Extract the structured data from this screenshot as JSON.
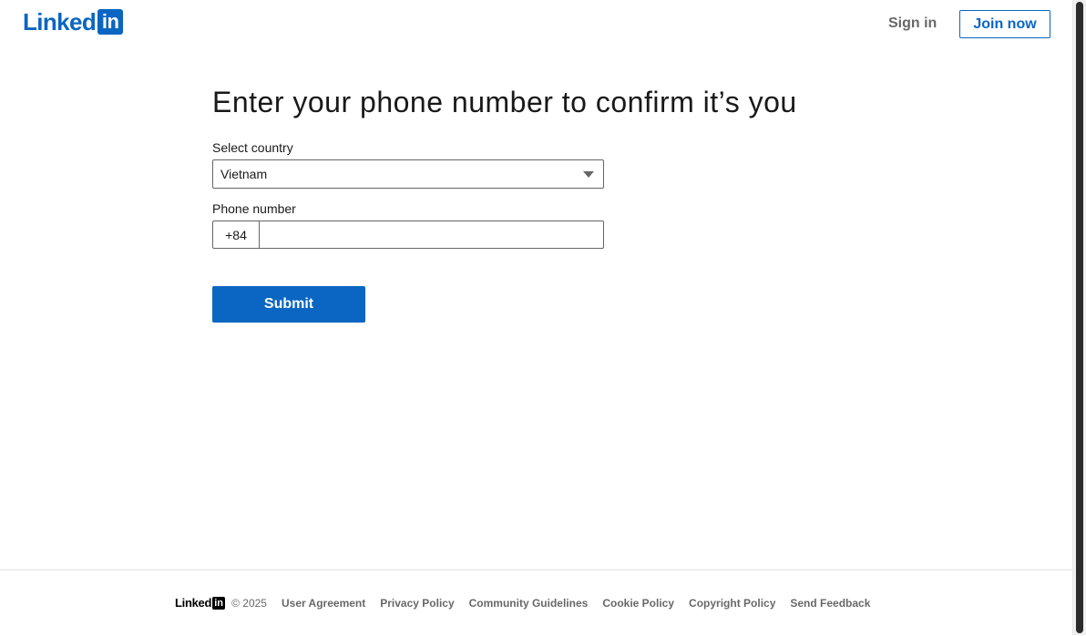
{
  "header": {
    "logo_word": "Linked",
    "logo_box": "in",
    "sign_in": "Sign in",
    "join_now": "Join now"
  },
  "main": {
    "title": "Enter your phone number to confirm it’s you",
    "country_label": "Select country",
    "country_value": "Vietnam",
    "phone_label": "Phone number",
    "phone_prefix": "+84",
    "phone_value": "",
    "submit_label": "Submit"
  },
  "footer": {
    "logo_word": "Linked",
    "logo_box": "in",
    "copyright": "© 2025",
    "links": [
      "User Agreement",
      "Privacy Policy",
      "Community Guidelines",
      "Cookie Policy",
      "Copyright Policy",
      "Send Feedback"
    ]
  },
  "colors": {
    "brand": "#0a66c2",
    "text_secondary": "rgba(0,0,0,0.6)"
  },
  "icons": {
    "caret": "chevron-down-icon"
  }
}
